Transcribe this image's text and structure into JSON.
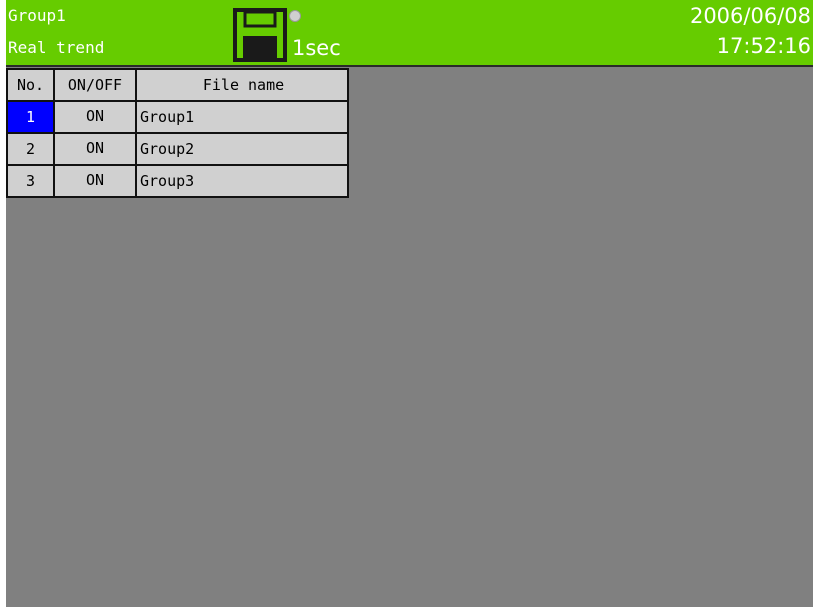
{
  "header": {
    "group": "Group1",
    "mode": "Real trend",
    "interval": "1sec",
    "date": "2006/06/08",
    "time": "17:52:16",
    "icons": [
      "floppy-disk-icon",
      "status-led-icon"
    ]
  },
  "table": {
    "headers": {
      "no": "No.",
      "onoff": "ON/OFF",
      "file": "File name"
    },
    "rows": [
      {
        "no": "1",
        "onoff": "ON",
        "file": "Group1"
      },
      {
        "no": "2",
        "onoff": "ON",
        "file": "Group2"
      },
      {
        "no": "3",
        "onoff": "ON",
        "file": "Group3"
      }
    ]
  },
  "colors": {
    "header_bg": "#66cc00",
    "screen_bg": "#808080",
    "cell_bg": "#d0d0d0",
    "selection": "#0000ff"
  }
}
